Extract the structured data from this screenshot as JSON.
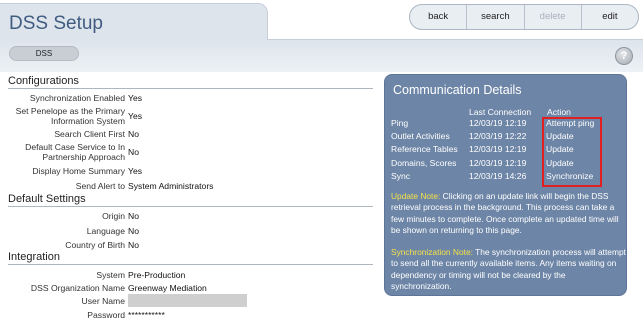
{
  "header": {
    "title": "DSS Setup",
    "buttons": {
      "back": "back",
      "search": "search",
      "delete": "delete",
      "edit": "edit"
    },
    "breadcrumb_pill": "DSS",
    "help": "?"
  },
  "configurations": {
    "heading": "Configurations",
    "rows": [
      {
        "label": "Synchronization Enabled",
        "value": "Yes"
      },
      {
        "label": "Set Penelope as the Primary Information System",
        "value": "Yes"
      },
      {
        "label": "Search Client First",
        "value": "No"
      },
      {
        "label": "Default Case Service to In Partnership Approach",
        "value": "No"
      },
      {
        "label": "Display Home Summary",
        "value": "Yes"
      },
      {
        "label": "Send Alert to",
        "value": "System Administrators"
      }
    ]
  },
  "default_settings": {
    "heading": "Default Settings",
    "rows": [
      {
        "label": "Origin",
        "value": "No"
      },
      {
        "label": "Language",
        "value": "No"
      },
      {
        "label": "Country of Birth",
        "value": "No"
      }
    ]
  },
  "integration": {
    "heading": "Integration",
    "rows": [
      {
        "label": "System",
        "value": "Pre-Production"
      },
      {
        "label": "DSS Organization Name",
        "value": "Greenway Mediation"
      },
      {
        "label": "User Name",
        "value": ""
      },
      {
        "label": "Password",
        "value": "***********"
      }
    ]
  },
  "communication": {
    "title": "Communication Details",
    "col_last": "Last Connection",
    "col_action": "Action",
    "rows": [
      {
        "name": "Ping",
        "last": "12/03/19 12:19",
        "action": "Attempt ping"
      },
      {
        "name": "Outlet Activities",
        "last": "12/03/19 12:22",
        "action": "Update"
      },
      {
        "name": "Reference Tables",
        "last": "12/03/19 12:19",
        "action": "Update"
      },
      {
        "name": "Domains, Scores",
        "last": "12/03/19 12:19",
        "action": "Update"
      },
      {
        "name": "Sync",
        "last": "12/03/19 14:26",
        "action": "Synchronize"
      }
    ],
    "update_note_key": "Update Note:",
    "update_note_text": " Clicking on an update link will begin the DSS retrieval process in the background. This process can take a few minutes to complete. Once complete an updated time will be shown on returning to this page.",
    "sync_note_key": "Synchronization Note:",
    "sync_note_text": " The synchronization process will attempt to send all the currently available items. Any items waiting on dependency or timing will not be cleared by the synchronization."
  },
  "colors": {
    "panel": "#6d85a6",
    "note_key": "#f6e24a",
    "highlight_box": "#e02020",
    "title": "#405c80"
  }
}
